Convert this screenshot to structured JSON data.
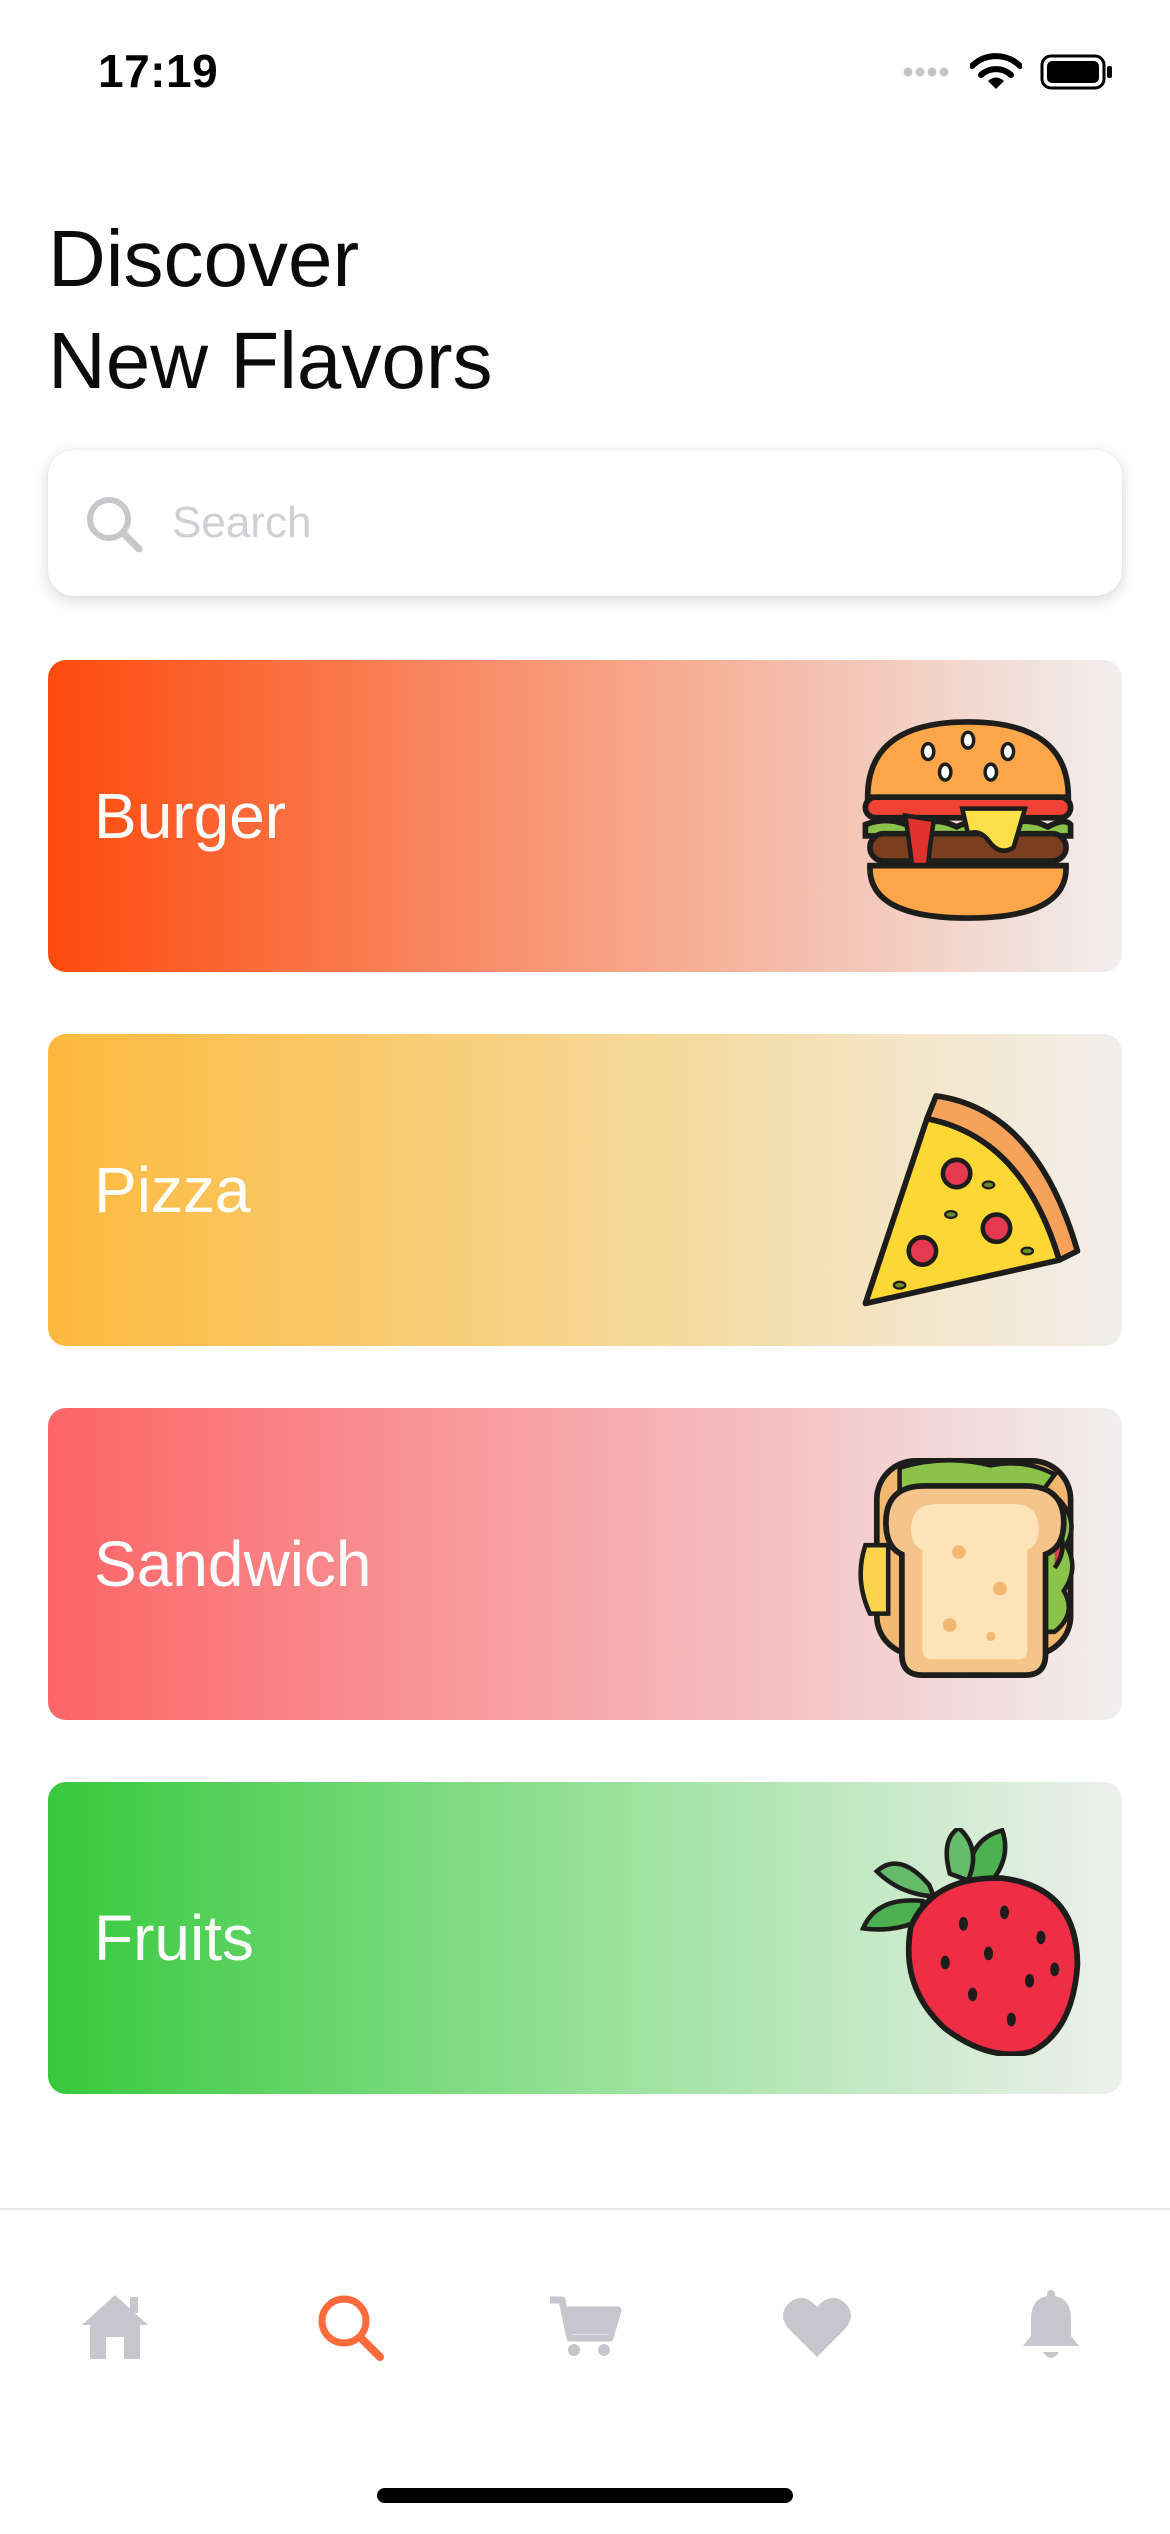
{
  "status_bar": {
    "time": "17:19"
  },
  "header": {
    "title_line1": "Discover",
    "title_line2": "New Flavors"
  },
  "search": {
    "placeholder": "Search",
    "value": ""
  },
  "categories": [
    {
      "label": "Burger",
      "icon": "burger-icon"
    },
    {
      "label": "Pizza",
      "icon": "pizza-icon"
    },
    {
      "label": "Sandwich",
      "icon": "sandwich-icon"
    },
    {
      "label": "Fruits",
      "icon": "strawberry-icon"
    }
  ],
  "tab_bar": {
    "tabs": [
      {
        "icon": "home-icon",
        "active": false
      },
      {
        "icon": "search-icon",
        "active": true
      },
      {
        "icon": "cart-icon",
        "active": false
      },
      {
        "icon": "heart-icon",
        "active": false
      },
      {
        "icon": "bell-icon",
        "active": false
      }
    ]
  },
  "colors": {
    "accent": "#fd6a3c",
    "inactive_tab": "#c6c6cc",
    "burger_gradient_start": "#fd4a0c",
    "pizza_gradient_start": "#fdb93d",
    "sandwich_gradient_start": "#fd6466",
    "fruits_gradient_start": "#37c93d"
  }
}
